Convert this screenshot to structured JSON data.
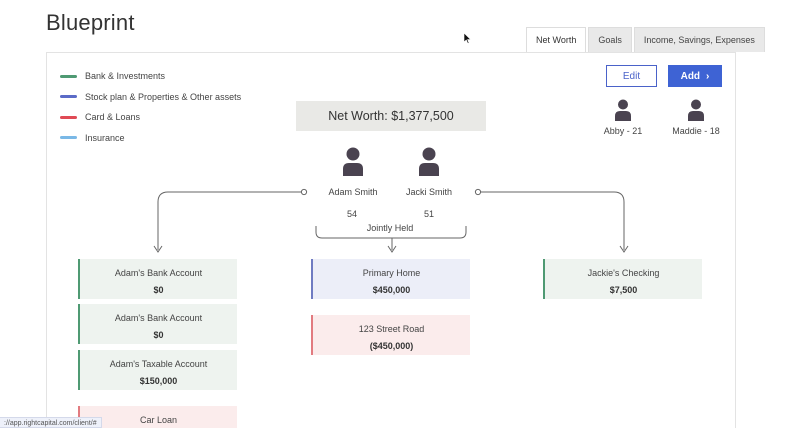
{
  "header": {
    "title": "Blueprint"
  },
  "tabs": [
    {
      "label": "Net Worth",
      "active": true
    },
    {
      "label": "Goals",
      "active": false
    },
    {
      "label": "Income, Savings, Expenses",
      "active": false
    }
  ],
  "legend": [
    {
      "label": "Bank & Investments",
      "color": "#4f9a73"
    },
    {
      "label": "Stock plan & Properties & Other assets",
      "color": "#5b6bc7"
    },
    {
      "label": "Card & Loans",
      "color": "#e04a55"
    },
    {
      "label": "Insurance",
      "color": "#7ab8e6"
    }
  ],
  "actions": {
    "edit_label": "Edit",
    "add_label": "Add",
    "add_icon": "›"
  },
  "networth": {
    "label": "Net Worth: $1,377,500"
  },
  "household": {
    "primary": [
      {
        "name": "Adam Smith",
        "age": "54"
      },
      {
        "name": "Jacki Smith",
        "age": "51"
      }
    ],
    "dependents": [
      {
        "label": "Abby - 21"
      },
      {
        "label": "Maddie - 18"
      }
    ],
    "jointly_label": "Jointly Held"
  },
  "accounts": {
    "adam": [
      {
        "name": "Adam's Bank Account",
        "amount": "$0"
      },
      {
        "name": "Adam's Bank Account",
        "amount": "$0"
      },
      {
        "name": "Adam's Taxable Account",
        "amount": "$150,000"
      },
      {
        "name": "Car Loan",
        "amount": ""
      }
    ],
    "joint": [
      {
        "name": "Primary Home",
        "amount": "$450,000"
      },
      {
        "name": "123 Street Road",
        "amount": "($450,000)"
      }
    ],
    "jacki": [
      {
        "name": "Jackie's Checking",
        "amount": "$7,500"
      }
    ]
  },
  "status_bar": {
    "url": "://app.rightcapital.com/client/#"
  }
}
